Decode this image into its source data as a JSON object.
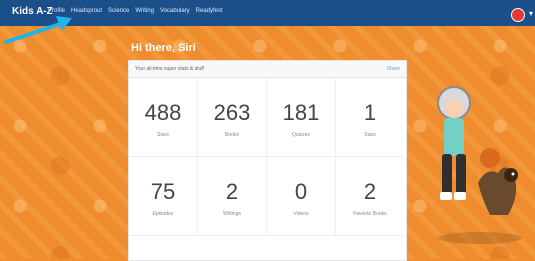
{
  "app": {
    "brand": "Kids A-Z",
    "nav": [
      "Profile",
      "Headsprout",
      "Science",
      "Writing",
      "Vocabulary",
      "Readyfest"
    ]
  },
  "greeting": "Hi there, Siri",
  "panel": {
    "title": "Your all-time super stats & stuff",
    "share": "Share"
  },
  "stats": [
    {
      "value": "488",
      "label": "Stars",
      "icon": "star-icon"
    },
    {
      "value": "263",
      "label": "Books",
      "icon": "book-icon"
    },
    {
      "value": "181",
      "label": "Quizzes",
      "icon": "quiz-icon"
    },
    {
      "value": "1",
      "label": "Stars",
      "icon": "star-icon"
    },
    {
      "value": "75",
      "label": "Episodes",
      "icon": "episode-icon"
    },
    {
      "value": "2",
      "label": "Writings",
      "icon": "writing-icon"
    },
    {
      "value": "0",
      "label": "Videos",
      "icon": "video-icon"
    },
    {
      "value": "2",
      "label": "Favorite Books",
      "icon": "heart-icon"
    }
  ],
  "colors": {
    "topbar": "#1b4f8a",
    "background": "#ef8d2e",
    "panel": "#ffffff"
  }
}
